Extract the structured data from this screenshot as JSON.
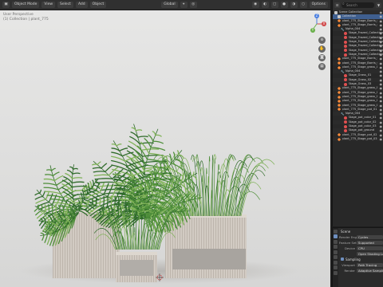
{
  "viewport": {
    "header": {
      "mode": "Object Mode",
      "menus": [
        "View",
        "Select",
        "Add",
        "Object"
      ],
      "transform_orientation": "Global",
      "shading_label": "Options"
    },
    "overlay": {
      "line1": "User Perspective",
      "line2": "(1) Collection | plant_775"
    },
    "gizmo": {
      "x": "X",
      "y": "Y",
      "z": "Z"
    }
  },
  "outliner": {
    "search_placeholder": "Search",
    "rows": [
      {
        "label": "Scene Collection",
        "icon": "collection-icon",
        "indent": 0,
        "selected": false
      },
      {
        "label": "Collection",
        "icon": "collection-icon",
        "indent": 1,
        "selected": true
      },
      {
        "label": "plant_775_Stage_Barris_Collection",
        "icon": "mesh-icon",
        "indent": 1,
        "selected": false
      },
      {
        "label": "plant_775_Stage_Barris_Collection",
        "icon": "mesh-icon",
        "indent": 1,
        "selected": false
      },
      {
        "label": "Alpha_004",
        "icon": "modifier-icon",
        "indent": 2,
        "selected": false
      },
      {
        "label": "Stage_Frazed_Collection_01",
        "icon": "material-icon",
        "indent": 3,
        "selected": false
      },
      {
        "label": "Stage_Frazed_Collection_02",
        "icon": "material-icon",
        "indent": 3,
        "selected": false
      },
      {
        "label": "Stage_Frazed_Collection_03",
        "icon": "material-icon",
        "indent": 3,
        "selected": false
      },
      {
        "label": "Stage_Frazed_Collection_04",
        "icon": "material-icon",
        "indent": 3,
        "selected": false
      },
      {
        "label": "Stage_Frazed_Collection_05",
        "icon": "material-icon",
        "indent": 3,
        "selected": false
      },
      {
        "label": "Stage_Frazed_Collection_06",
        "icon": "material-icon",
        "indent": 3,
        "selected": false
      },
      {
        "label": "plant_775_Stage_Barris_Collection",
        "icon": "mesh-icon",
        "indent": 1,
        "selected": false
      },
      {
        "label": "plant_775_Stage_Barris_Collection",
        "icon": "mesh-icon",
        "indent": 1,
        "selected": false
      },
      {
        "label": "plant_775_Stage_grass_01",
        "icon": "mesh-icon",
        "indent": 1,
        "selected": false
      },
      {
        "label": "Alpha_004",
        "icon": "modifier-icon",
        "indent": 2,
        "selected": false
      },
      {
        "label": "Stage_Grass_01",
        "icon": "material-icon",
        "indent": 3,
        "selected": false
      },
      {
        "label": "Stage_Grass_02",
        "icon": "material-icon",
        "indent": 3,
        "selected": false
      },
      {
        "label": "Stage_Grass_03",
        "icon": "material-icon",
        "indent": 3,
        "selected": false
      },
      {
        "label": "plant_775_Stage_grass_02",
        "icon": "mesh-icon",
        "indent": 1,
        "selected": false
      },
      {
        "label": "plant_775_Stage_grass_03",
        "icon": "mesh-icon",
        "indent": 1,
        "selected": false
      },
      {
        "label": "plant_775_Stage_grass_04",
        "icon": "mesh-icon",
        "indent": 1,
        "selected": false
      },
      {
        "label": "plant_775_Stage_grass_05",
        "icon": "mesh-icon",
        "indent": 1,
        "selected": false
      },
      {
        "label": "plant_775_Stage_grass_06",
        "icon": "mesh-icon",
        "indent": 1,
        "selected": false
      },
      {
        "label": "plant_775_Stage_pot_01",
        "icon": "mesh-icon",
        "indent": 1,
        "selected": false
      },
      {
        "label": "Alpha_004",
        "icon": "modifier-icon",
        "indent": 2,
        "selected": false
      },
      {
        "label": "Stage_pot_color_01",
        "icon": "material-icon",
        "indent": 3,
        "selected": false
      },
      {
        "label": "Stage_pot_color_02",
        "icon": "material-icon",
        "indent": 3,
        "selected": false
      },
      {
        "label": "Stage_pot_color_03",
        "icon": "material-icon",
        "indent": 3,
        "selected": false
      },
      {
        "label": "Stage_pot_ground",
        "icon": "material-icon",
        "indent": 3,
        "selected": false
      },
      {
        "label": "plant_775_Stage_pot_02",
        "icon": "mesh-icon",
        "indent": 1,
        "selected": false
      },
      {
        "label": "plant_775_Stage_pot_03",
        "icon": "mesh-icon",
        "indent": 1,
        "selected": false
      }
    ]
  },
  "properties": {
    "section": "Scene",
    "rows": [
      {
        "label": "Render Engine",
        "value": "Cycles"
      },
      {
        "label": "Feature Set",
        "value": "Supported"
      },
      {
        "label": "Device",
        "value": "CPU"
      },
      {
        "label": "",
        "value": "Open Shading Language"
      }
    ],
    "sampling_label": "Sampling",
    "viewport_row": {
      "label": "Viewport",
      "value": "Path Tracing"
    },
    "render_row": {
      "label": "Render",
      "value": "Adaptive Sampling"
    }
  },
  "colors": {
    "leaf_dark": "#2f6b2a",
    "leaf_mid": "#4f8f3a",
    "leaf_light": "#7fb257",
    "pot": "#cfc8c0",
    "pot_shadow": "#a89f96",
    "accent": "#6e8fbf"
  }
}
